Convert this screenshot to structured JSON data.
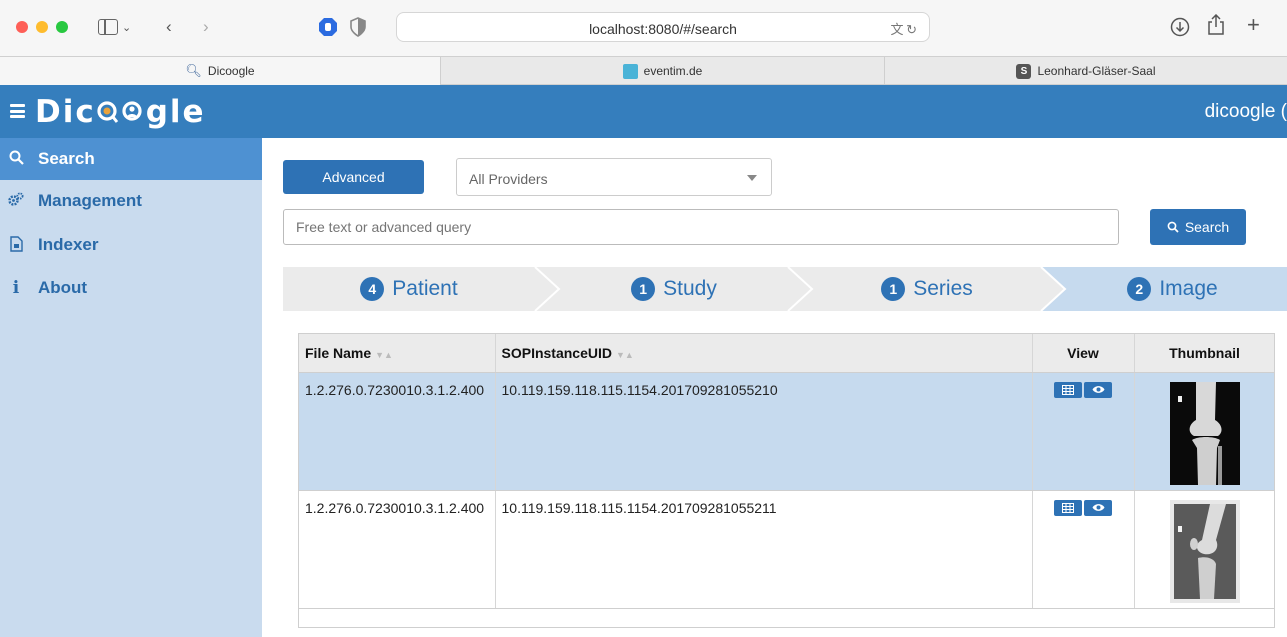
{
  "browser": {
    "url": "localhost:8080/#/search",
    "tabs": [
      {
        "label": "Dicoogle",
        "icon": "search-icon"
      },
      {
        "label": "eventim.de",
        "icon": "square-favicon"
      },
      {
        "label": "Leonhard-Gläser-Saal",
        "icon": "s-favicon",
        "favicon_letter": "S"
      }
    ]
  },
  "app": {
    "brand_prefix": "Dic",
    "brand_suffix": "gle",
    "user": "dicoogle ("
  },
  "sidebar": {
    "items": [
      {
        "label": "Search",
        "icon": "search-icon",
        "active": true
      },
      {
        "label": "Management",
        "icon": "gears-icon",
        "active": false
      },
      {
        "label": "Indexer",
        "icon": "file-icon",
        "active": false
      },
      {
        "label": "About",
        "icon": "info-icon",
        "active": false
      }
    ]
  },
  "search": {
    "advanced_label": "Advanced",
    "provider_value": "All Providers",
    "query_placeholder": "Free text or advanced query",
    "search_label": "Search"
  },
  "steps": [
    {
      "count": "4",
      "label": "Patient"
    },
    {
      "count": "1",
      "label": "Study"
    },
    {
      "count": "1",
      "label": "Series"
    },
    {
      "count": "2",
      "label": "Image"
    }
  ],
  "table": {
    "headers": [
      "File Name",
      "SOPInstanceUID",
      "View",
      "Thumbnail"
    ],
    "rows": [
      {
        "file_name": "1.2.276.0.7230010.3.1.2.400",
        "sop_uid": "10.119.159.118.115.1154.201709281055210"
      },
      {
        "file_name": "1.2.276.0.7230010.3.1.2.400",
        "sop_uid": "10.119.159.118.115.1154.201709281055211"
      }
    ]
  },
  "colors": {
    "header_blue": "#357ebd",
    "sidebar_bg": "#c9dbee",
    "sidebar_active": "#4e91d2",
    "button_blue": "#2e72b5",
    "row_highlight": "#c6daee"
  }
}
